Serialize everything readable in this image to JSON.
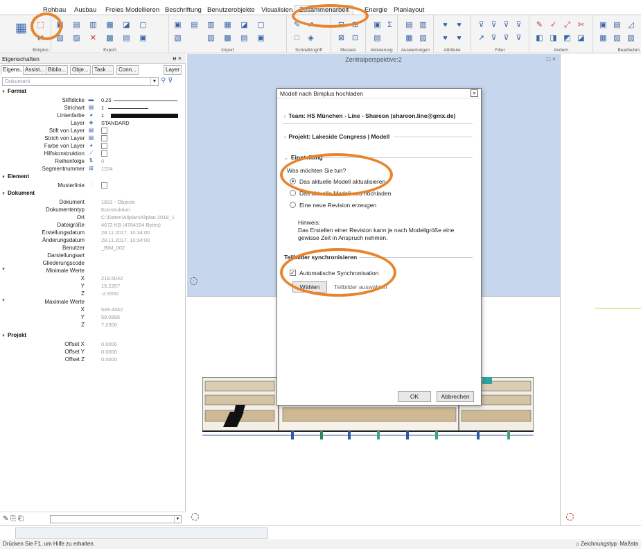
{
  "ribbon": {
    "tabs": [
      "Rohbau",
      "Ausbau",
      "Freies Modellieren",
      "Beschriftung",
      "Benutzerobjekte",
      "Visualisierung",
      "Zusammenarbeit",
      "Energie",
      "Planlayout"
    ],
    "active_tab": "Zusammenarbeit",
    "groups": [
      "Bimplus",
      "Export",
      "Import",
      "Schnellzugriff",
      "Messen",
      "Aktivierung",
      "Auswertungen",
      "Attribute",
      "Filter",
      "Ändern",
      "Bearbeiten"
    ]
  },
  "properties_panel": {
    "title": "Eigenschaften",
    "title_controls": "ᵾ ×",
    "tabs": [
      "Eigens...",
      "Assist...",
      "Biblio...",
      "Obje...",
      "Task ...",
      "Conn...",
      "Layer"
    ],
    "selector_value": "Dokument",
    "sections": {
      "format": "Format",
      "element": "Element",
      "dokument": "Dokument",
      "projekt": "Projekt"
    },
    "format_rows": [
      {
        "label": "Stiftdicke",
        "value": "0.25"
      },
      {
        "label": "Strichart",
        "value": "1"
      },
      {
        "label": "Linienfarbe",
        "value": "1"
      },
      {
        "label": "Layer",
        "value": "STANDARD"
      },
      {
        "label": "Stift von Layer",
        "value": ""
      },
      {
        "label": "Strich von Layer",
        "value": ""
      },
      {
        "label": "Farbe von Layer",
        "value": ""
      },
      {
        "label": "Hilfskonstruktion",
        "value": ""
      },
      {
        "label": "Reihenfolge",
        "value": "0"
      },
      {
        "label": "Segmentnummer",
        "value": "1224"
      }
    ],
    "element_rows": [
      {
        "label": "Musterlinie",
        "value": ""
      }
    ],
    "dokument_rows": [
      {
        "label": "Dokument",
        "value": "1831 - Objects"
      },
      {
        "label": "Dokumententyp",
        "value": "Konstruktion"
      },
      {
        "label": "Ort",
        "value": "C:\\Daten\\Allplan\\Allplan 2018_1"
      },
      {
        "label": "Dateigröße",
        "value": "4672 KB (4784154 Bytes)"
      },
      {
        "label": "Erstellungsdatum",
        "value": "28.11.2017, 10:34:00"
      },
      {
        "label": "Änderungsdatum",
        "value": "28.11.2017, 10:34:00"
      },
      {
        "label": "Benutzer",
        "value": "_BIM_002"
      },
      {
        "label": "Darstellungsart",
        "value": ""
      },
      {
        "label": "Gliederungscode",
        "value": ""
      }
    ],
    "min_header": "Minimale Werte",
    "min_values": [
      {
        "label": "X",
        "value": "218.5042"
      },
      {
        "label": "Y",
        "value": "15.2257"
      },
      {
        "label": "Z",
        "value": "-2.9350"
      }
    ],
    "max_header": "Maximale Werte",
    "max_values": [
      {
        "label": "X",
        "value": "549.4442"
      },
      {
        "label": "Y",
        "value": "59.0995"
      },
      {
        "label": "Z",
        "value": "7.2300"
      }
    ],
    "projekt_rows": [
      {
        "label": "Offset X",
        "value": "0.0000"
      },
      {
        "label": "Offset Y",
        "value": "0.0000"
      },
      {
        "label": "Offset Z",
        "value": "0.0000"
      }
    ]
  },
  "viewport": {
    "title": "Zentralperspektive:2",
    "controls": "□ ×"
  },
  "dialog": {
    "title": "Modell nach Bimplus hochladen",
    "close": "×",
    "team": "Team: HS München - Line - Shareon (shareon.line@gmx.de)",
    "projekt": "Projekt: Lakeside Congress | Modell",
    "einstellung": "Einstellung",
    "question": "Was möchten Sie tun?",
    "options": [
      {
        "label": "Das aktuelle Modell aktualisieren",
        "selected": true
      },
      {
        "label": "Das aktuelle Modell neu hochladen",
        "selected": false
      },
      {
        "label": "Eine neue Revision erzeugen",
        "selected": false
      }
    ],
    "hint_title": "Hinweis:",
    "hint_text": "Das Erstellen einer Revision kann je nach Modellgröße eine gewisse Zeit in Anspruch nehmen.",
    "sync_header": "Teilbilder synchronisieren",
    "auto_sync_label": "Automatische Synchronisation",
    "auto_sync_checked": true,
    "choose_button": "Wählen",
    "choose_hint": "Teilbilder auswählen",
    "ok_button": "OK",
    "cancel_button": "Abbrechen"
  },
  "statusbar": {
    "help": "Drücken Sie F1, um Hilfe zu erhalten.",
    "right": "Zeichnungstyp:  Maßsta"
  },
  "colors": {
    "highlight": "#e8842c",
    "viewport_blue": "#c6d6ec",
    "icon_blue": "#3a66a8"
  }
}
